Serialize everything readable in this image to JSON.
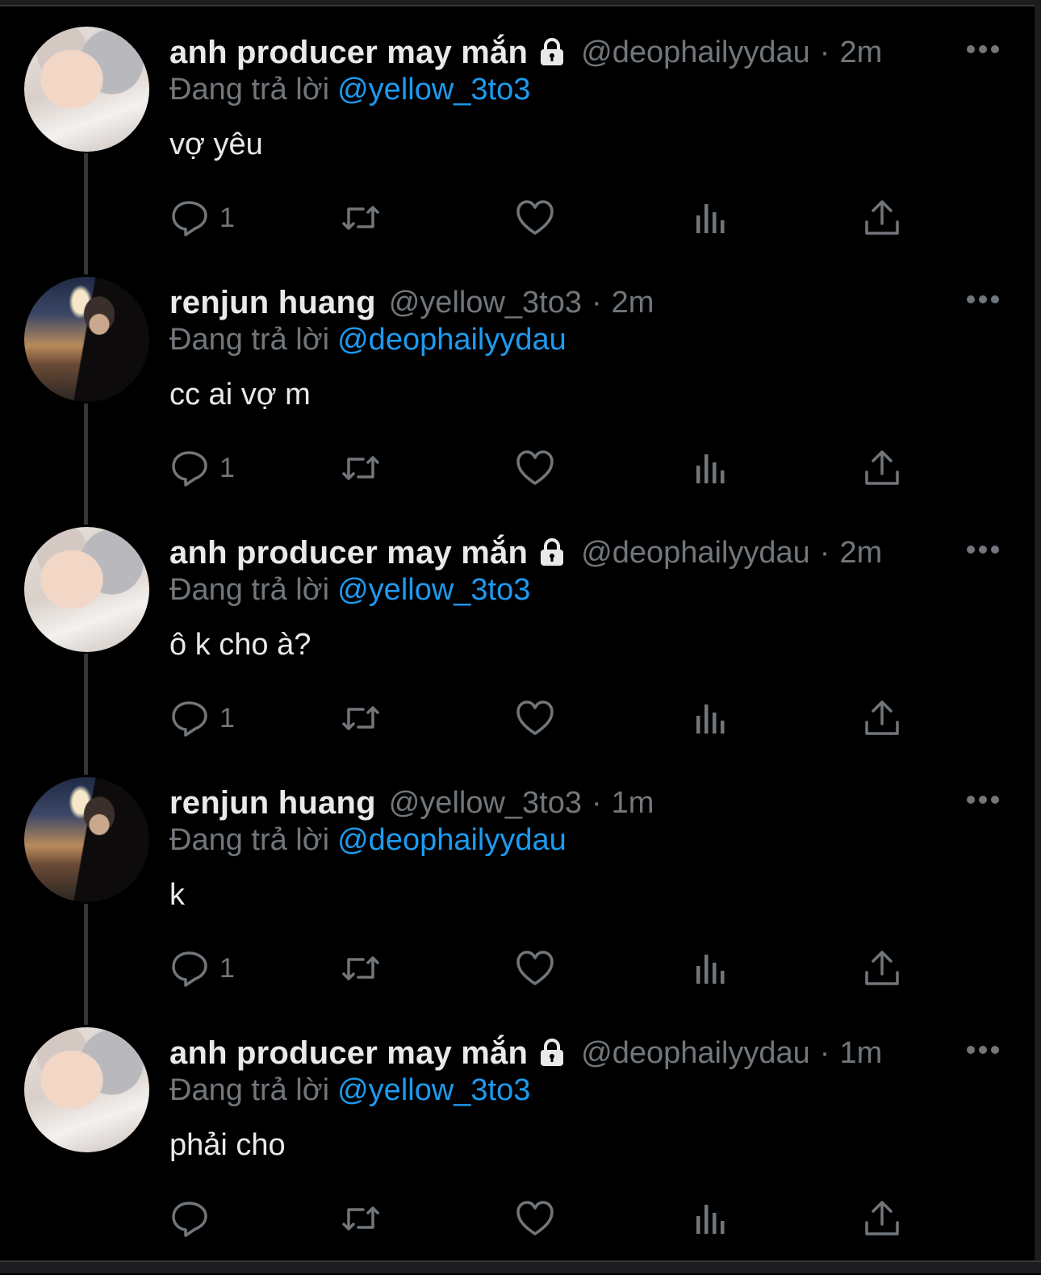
{
  "colors": {
    "background": "#000000",
    "text": "#e7e9ea",
    "muted": "#71767b",
    "mention": "#1d9bf0",
    "thread_line": "#333639"
  },
  "labels": {
    "replying_prefix": "Đang trả lời",
    "dot": "·"
  },
  "icons": {
    "reply": "reply-icon",
    "retweet": "retweet-icon",
    "like": "heart-icon",
    "views": "views-icon",
    "share": "share-icon",
    "more": "more-icon",
    "protected": "lock-icon"
  },
  "tweets": [
    {
      "name": "anh producer may mắn",
      "protected": true,
      "handle": "@deophailyydau",
      "time": "2m",
      "replying_to": "@yellow_3to3",
      "text": "vợ yêu",
      "reply_count": "1"
    },
    {
      "name": "renjun huang",
      "protected": false,
      "handle": "@yellow_3to3",
      "time": "2m",
      "replying_to": "@deophailyydau",
      "text": "cc ai vợ m",
      "reply_count": "1"
    },
    {
      "name": "anh producer may mắn",
      "protected": true,
      "handle": "@deophailyydau",
      "time": "2m",
      "replying_to": "@yellow_3to3",
      "text": "ô k cho à?",
      "reply_count": "1"
    },
    {
      "name": "renjun huang",
      "protected": false,
      "handle": "@yellow_3to3",
      "time": "1m",
      "replying_to": "@deophailyydau",
      "text": "k",
      "reply_count": "1"
    },
    {
      "name": "anh producer may mắn",
      "protected": true,
      "handle": "@deophailyydau",
      "time": "1m",
      "replying_to": "@yellow_3to3",
      "text": "phải cho",
      "reply_count": ""
    }
  ]
}
